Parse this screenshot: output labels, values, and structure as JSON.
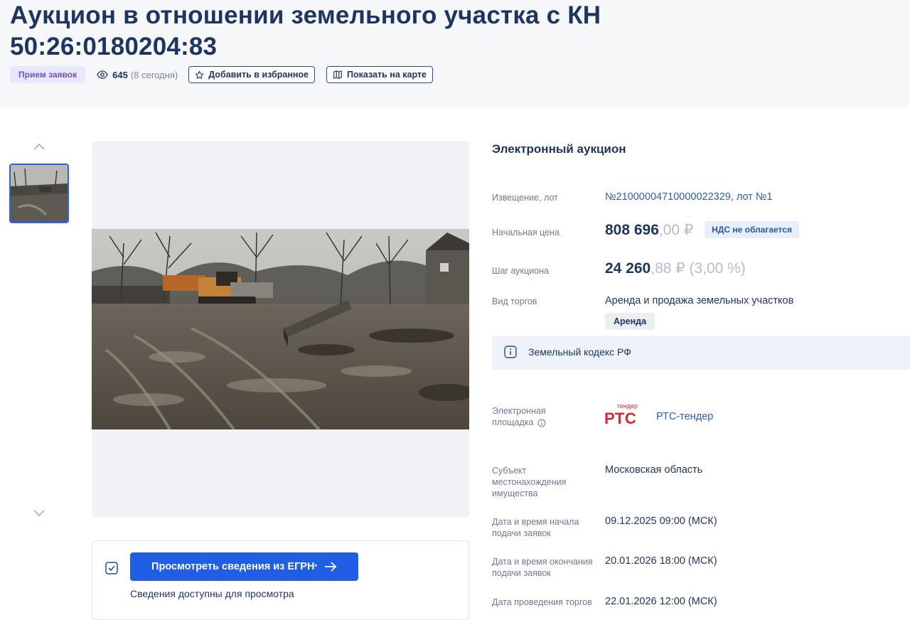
{
  "header": {
    "title": "Аукцион в отношении земельного участка с КН 50:26:0180204:83",
    "status_badge": "Прием заявок",
    "views_count": "645",
    "views_today": "(8 сегодня)",
    "favorite_label": "Добавить в избранное",
    "map_label": "Показать на карте"
  },
  "gallery": {
    "photo_alt": "Фото земельного участка"
  },
  "egrn": {
    "button_label": "Просмотреть сведения из ЕГРН",
    "button_sup": "*",
    "note": "Сведения доступны для просмотра"
  },
  "details": {
    "section_title": "Электронный аукцион",
    "notice_label": "Извещение, лот",
    "notice_value": "№21000004710000022329, лот №1",
    "start_price_label": "Начальная цена",
    "start_price_int": "808 696",
    "start_price_dec": ",00 ₽",
    "vat_badge": "НДС не облагается",
    "step_label": "Шаг аукциона",
    "step_int": "24 260",
    "step_dec": ",88 ₽ (3,00 %)",
    "trade_type_label": "Вид торгов",
    "trade_type_value": "Аренда и продажа земельных участков",
    "trade_tag": "Аренда",
    "law_info": "Земельный кодекс РФ",
    "platform_label": "Электронная площадка",
    "platform_logo_small": "тендер",
    "platform_logo_big": "РТС",
    "platform_name": "РТС-тендер",
    "region_label": "Субъект местонахождения имущества",
    "region_value": "Московская область",
    "start_date_label": "Дата и время начала подачи заявок",
    "start_date_value": "09.12.2025 09:00 (МСК)",
    "end_date_label": "Дата и время окончания подачи заявок",
    "end_date_value": "20.01.2026 18:00 (МСК)",
    "auction_date_label": "Дата проведения торгов",
    "auction_date_value": "22.01.2026 12:00 (МСК)"
  },
  "colors": {
    "primary": "#1f5ee5",
    "title": "#1f3561",
    "badge_bg": "#ebe6fb",
    "badge_text": "#6a55c9",
    "logo_red": "#d9282f"
  }
}
